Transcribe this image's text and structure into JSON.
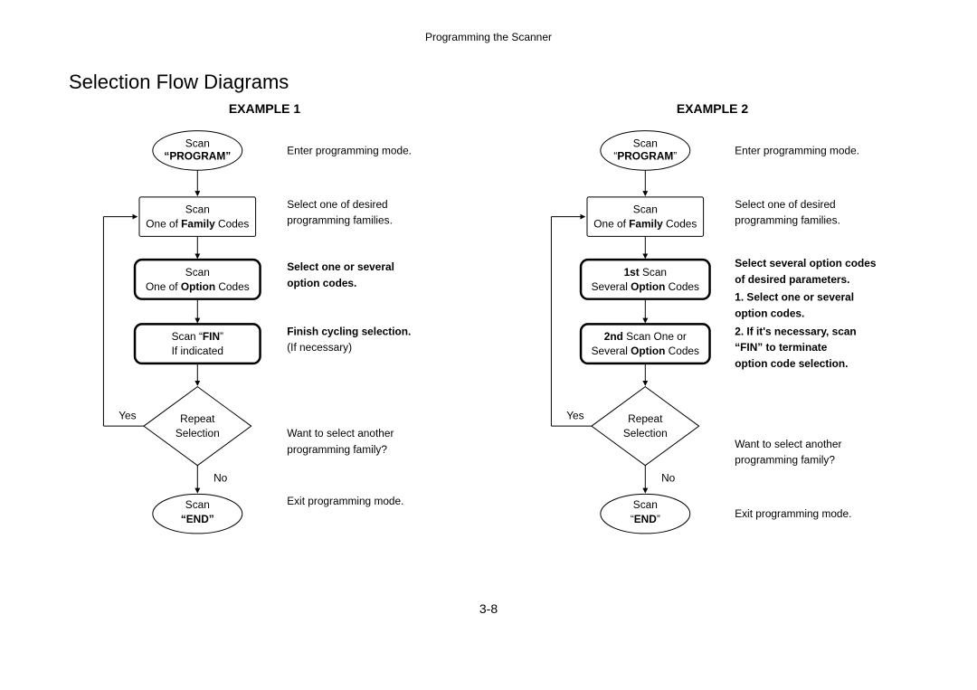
{
  "header": "Programming the Scanner",
  "title": "Selection Flow Diagrams",
  "pageNumber": "3-8",
  "example1": {
    "title": "EXAMPLE 1",
    "start_line1": "Scan",
    "start_line2": "“PROGRAM”",
    "family_line1": "Scan",
    "family_prefix": "One of ",
    "family_bold": "Family",
    "family_suffix": " Codes",
    "option_line1": "Scan",
    "option_prefix": "One of ",
    "option_bold": "Option",
    "option_suffix": " Codes",
    "fin_line1_prefix": "Scan “",
    "fin_line1_bold": "FIN",
    "fin_line1_suffix": "”",
    "fin_line2": "If indicated",
    "decision_line1": "Repeat",
    "decision_line2": "Selection",
    "yes": "Yes",
    "no": "No",
    "end_line1": "Scan",
    "end_line2": "“END”",
    "note1": "Enter programming mode.",
    "note2a": "Select one of desired",
    "note2b": "programming families.",
    "note3a": "Select one or several",
    "note3b": "option codes.",
    "note4a": "Finish cycling selection.",
    "note4b": "(If necessary)",
    "note5a": "Want to select another",
    "note5b": "programming family?",
    "note6": "Exit programming mode."
  },
  "example2": {
    "title": "EXAMPLE 2",
    "start_line1": "Scan",
    "start_line2": "“PROGRAM”",
    "family_line1": "Scan",
    "family_prefix": "One of ",
    "family_bold": "Family",
    "family_suffix": " Codes",
    "opt1_line1_bold": "1st",
    "opt1_line1_suffix": " Scan",
    "opt1_line2_prefix": "Several ",
    "opt1_line2_bold": "Option",
    "opt1_line2_suffix": " Codes",
    "opt2_line1_bold": "2nd",
    "opt2_line1_suffix": " Scan One or",
    "opt2_line2_prefix": "Several ",
    "opt2_line2_bold": "Option",
    "opt2_line2_suffix": " Codes",
    "decision_line1": "Repeat",
    "decision_line2": "Selection",
    "yes": "Yes",
    "no": "No",
    "end_line1": "Scan",
    "end_line2": "“END”",
    "note1": "Enter programming mode.",
    "note2a": "Select one of desired",
    "note2b": "programming families.",
    "note3a": "Select several option codes",
    "note3b": "of desired parameters.",
    "note3c": "1. Select one or several",
    "note3d": "    option codes.",
    "note3e": "2. If it's necessary, scan",
    "note3f": "    “FIN” to terminate",
    "note3g": "    option code selection.",
    "note5a": "Want to select another",
    "note5b": "programming family?",
    "note6": "Exit programming mode."
  }
}
